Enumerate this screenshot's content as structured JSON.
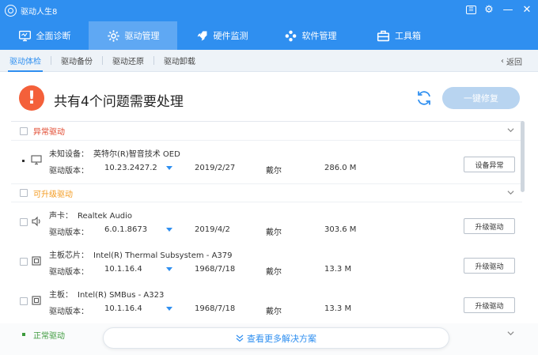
{
  "app": {
    "title": "驱动人生8"
  },
  "nav": [
    {
      "label": "全面诊断",
      "icon": "monitor-icon"
    },
    {
      "label": "驱动管理",
      "icon": "gear-icon"
    },
    {
      "label": "硬件监测",
      "icon": "rocket-icon"
    },
    {
      "label": "软件管理",
      "icon": "apps-icon"
    },
    {
      "label": "工具箱",
      "icon": "toolbox-icon"
    }
  ],
  "subtabs": [
    "驱动体检",
    "驱动备份",
    "驱动还原",
    "驱动卸载"
  ],
  "back_label": "返回",
  "summary": {
    "text": "共有4个问题需要处理",
    "fix_button": "一键修复"
  },
  "sections": {
    "abnormal": "异常驱动",
    "upgradable": "可升级驱动",
    "normal": "正常驱动"
  },
  "version_label": "驱动版本：",
  "rows": [
    {
      "type": "未知设备：",
      "name": "英特尔(R)智音技术 OED",
      "version": "10.23.2427.2",
      "date": "2019/2/27",
      "vendor": "戴尔",
      "size": "286.0 M",
      "action": "设备异常",
      "icon": "monitor-icon"
    },
    {
      "type": "声卡：",
      "name": "Realtek Audio",
      "version": "6.0.1.8673",
      "date": "2019/4/2",
      "vendor": "戴尔",
      "size": "303.6 M",
      "action": "升级驱动",
      "icon": "speaker-icon"
    },
    {
      "type": "主板芯片：",
      "name": "Intel(R) Thermal Subsystem - A379",
      "version": "10.1.16.4",
      "date": "1968/7/18",
      "vendor": "戴尔",
      "size": "13.3 M",
      "action": "升级驱动",
      "icon": "chip-icon"
    },
    {
      "type": "主板：",
      "name": "Intel(R) SMBus - A323",
      "version": "10.1.16.4",
      "date": "1968/7/18",
      "vendor": "戴尔",
      "size": "13.3 M",
      "action": "升级驱动",
      "icon": "chip-icon"
    }
  ],
  "more_label": "查看更多解决方案",
  "colors": {
    "primary": "#2f8ff0",
    "warning": "#f4603a",
    "abnormal_label": "#e0442a",
    "upgradable_label": "#f39a1e",
    "normal_label": "#3c9a3c"
  }
}
